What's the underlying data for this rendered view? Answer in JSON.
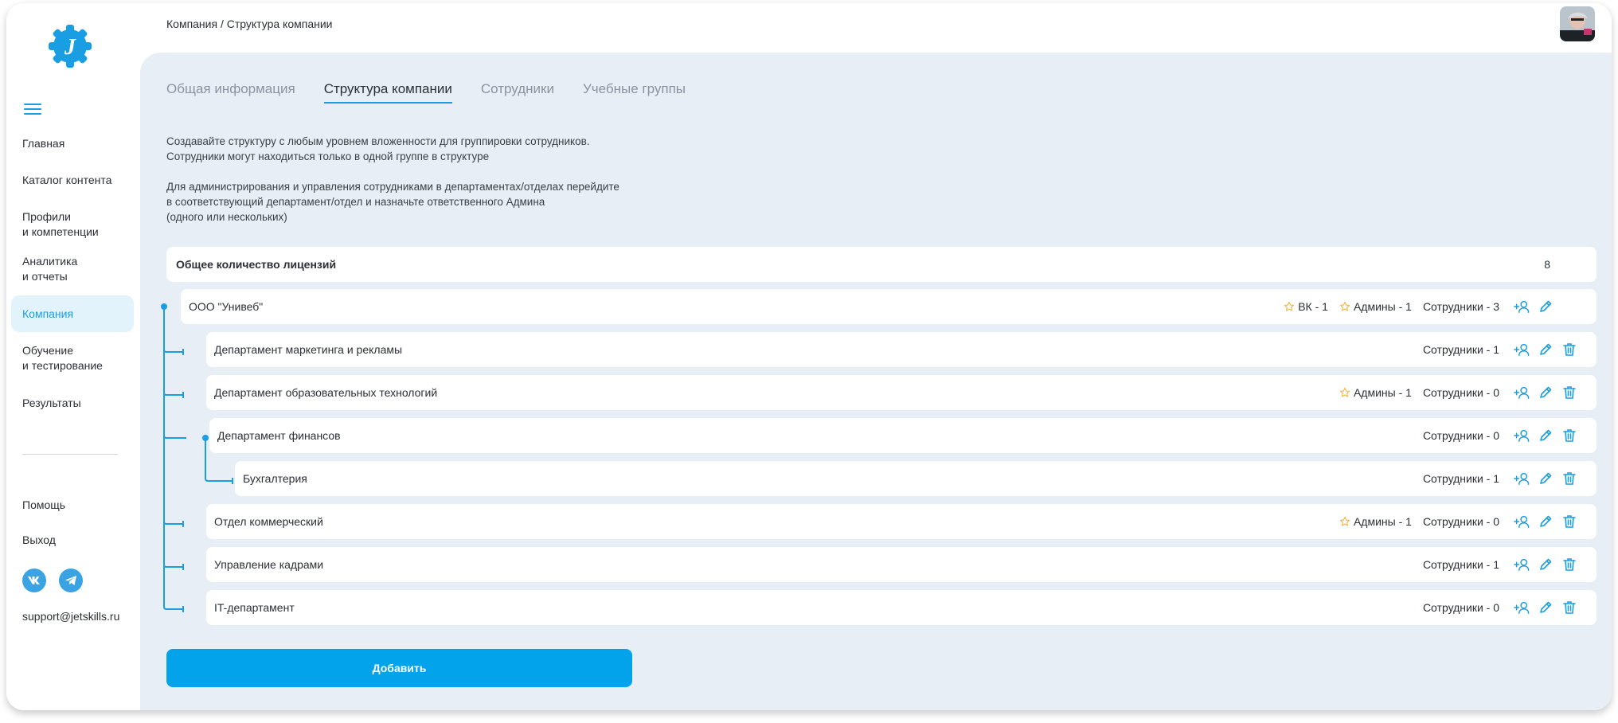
{
  "breadcrumb": "Компания / Структура компании",
  "sidebar": {
    "items": [
      {
        "label": "Главная",
        "active": false
      },
      {
        "label": "Каталог контента",
        "active": false
      },
      {
        "label": "Профили\nи компетенции",
        "active": false
      },
      {
        "label": "Аналитика\nи отчеты",
        "active": false
      },
      {
        "label": "Компания",
        "active": true
      },
      {
        "label": "Обучение\nи тестирование",
        "active": false
      },
      {
        "label": "Результаты",
        "active": false
      }
    ],
    "help": "Помощь",
    "logout": "Выход",
    "support_email": "support@jetskills.ru",
    "logo_letter": "J",
    "social": [
      "vk-icon",
      "telegram-icon"
    ]
  },
  "tabs": [
    {
      "label": "Общая информация",
      "active": false
    },
    {
      "label": "Структура компании",
      "active": true
    },
    {
      "label": "Сотрудники",
      "active": false
    },
    {
      "label": "Учебные группы",
      "active": false
    }
  ],
  "description": {
    "line1": "Создавайте структуру с любым уровнем вложенности для группировки сотрудников.",
    "line2": "Сотрудники могут находиться только в одной группе в структуре",
    "line3": "Для администрирования и управления сотрудниками в департаментах/отделах перейдите",
    "line4": "в соответствующий департамент/отдел и назначьте ответственного Админа",
    "line5": "(одного или нескольких)"
  },
  "license": {
    "label": "Общее количество лицензий",
    "value": "8"
  },
  "structure": [
    {
      "name": "ООО \"Унивеб\"",
      "vk": "ВК - 1",
      "admins": "Админы - 1",
      "employees": "Сотрудники - 3",
      "deletable": false
    },
    {
      "name": "Департамент маркетинга и рекламы",
      "vk": "",
      "admins": "",
      "employees": "Сотрудники - 1",
      "deletable": true
    },
    {
      "name": "Департамент образовательных технологий",
      "vk": "",
      "admins": "Админы - 1",
      "employees": "Сотрудники - 0",
      "deletable": true
    },
    {
      "name": "Департамент финансов",
      "vk": "",
      "admins": "",
      "employees": "Сотрудники - 0",
      "deletable": true
    },
    {
      "name": "Бухгалтерия",
      "vk": "",
      "admins": "",
      "employees": "Сотрудники - 1",
      "deletable": true
    },
    {
      "name": "Отдел коммерческий",
      "vk": "",
      "admins": "Админы - 1",
      "employees": "Сотрудники - 0",
      "deletable": true
    },
    {
      "name": "Управление кадрами",
      "vk": "",
      "admins": "",
      "employees": "Сотрудники - 1",
      "deletable": true
    },
    {
      "name": "IT-департамент",
      "vk": "",
      "admins": "",
      "employees": "Сотрудники - 0",
      "deletable": true
    }
  ],
  "add_button": "Добавить",
  "colors": {
    "accent": "#03a3ec",
    "star": "#f5b940",
    "background": "#e8eef5"
  }
}
